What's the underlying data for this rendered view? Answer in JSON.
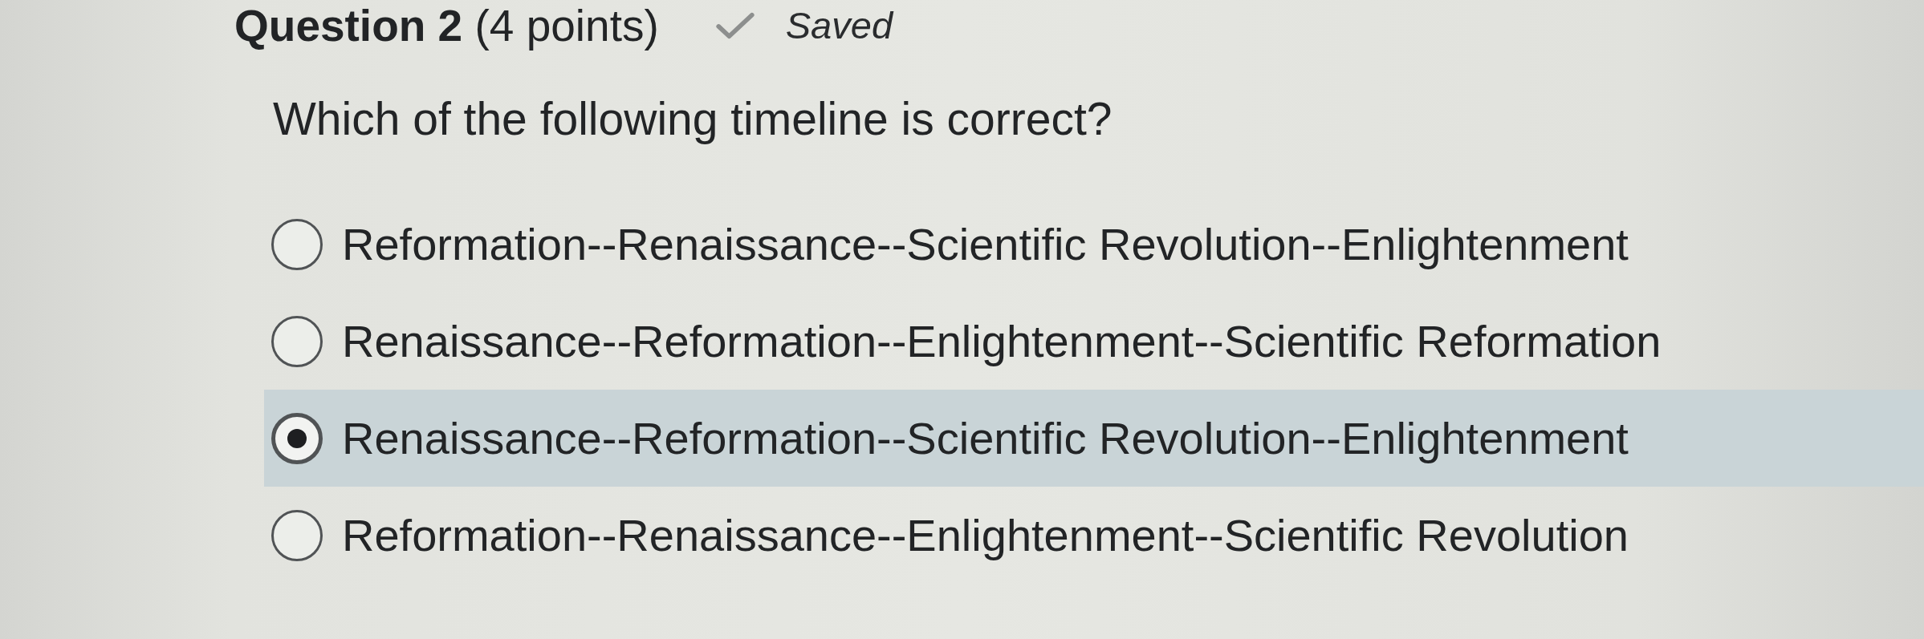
{
  "question": {
    "title": "**Question 2** (4 points)",
    "status": {
      "kind": "saved",
      "label": "Saved"
    },
    "prompt": "Which of the following timeline is correct?",
    "options": [
      {
        "label": "Reformation--Renaissance--Scientific Revolution--Enlightenment",
        "selected": false
      },
      {
        "label": "Renaissance--Reformation--Enlightenment--Scientific Reformation",
        "selected": false
      },
      {
        "label": "Renaissance--Reformation--Scientific Revolution--Enlightenment",
        "selected": true
      },
      {
        "label": "Reformation--Renaissance--Enlightenment--Scientific Revolution",
        "selected": false
      }
    ]
  }
}
